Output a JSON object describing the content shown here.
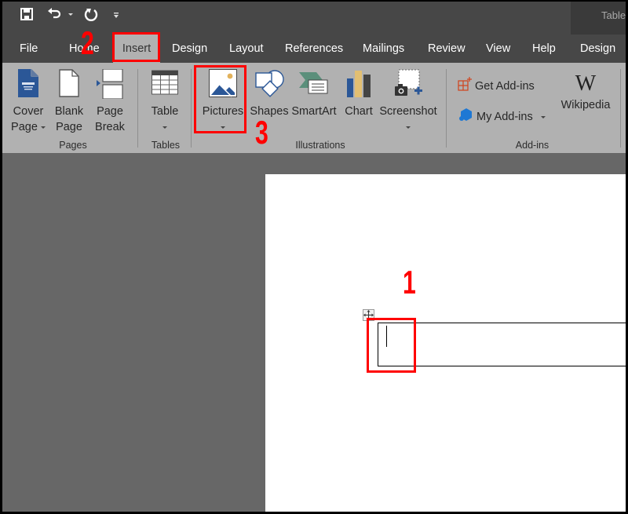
{
  "window": {
    "contextual_tab_group": "Table"
  },
  "quick_access": [
    {
      "name": "save-icon"
    },
    {
      "name": "undo-icon"
    },
    {
      "name": "redo-icon"
    },
    {
      "name": "customize-qat-icon"
    }
  ],
  "tabs": [
    {
      "label": "File",
      "active": false
    },
    {
      "label": "Home",
      "active": false
    },
    {
      "label": "Insert",
      "active": true
    },
    {
      "label": "Design",
      "active": false
    },
    {
      "label": "Layout",
      "active": false
    },
    {
      "label": "References",
      "active": false
    },
    {
      "label": "Mailings",
      "active": false
    },
    {
      "label": "Review",
      "active": false
    },
    {
      "label": "View",
      "active": false
    },
    {
      "label": "Help",
      "active": false
    },
    {
      "label": "Design",
      "active": false,
      "contextual": true
    }
  ],
  "ribbon": {
    "groups": {
      "pages": "Pages",
      "tables": "Tables",
      "illustrations": "Illustrations",
      "addins": "Add-ins"
    },
    "buttons": {
      "cover_page": [
        "Cover",
        "Page"
      ],
      "blank_page": [
        "Blank",
        "Page"
      ],
      "page_break": [
        "Page",
        "Break"
      ],
      "table": "Table",
      "pictures": "Pictures",
      "shapes": "Shapes",
      "smartart": "SmartArt",
      "chart": "Chart",
      "screenshot": "Screenshot",
      "get_addins": "Get Add-ins",
      "my_addins": "My Add-ins",
      "wikipedia": "Wikipedia",
      "wikipedia_glyph": "W"
    }
  },
  "annotations": {
    "step1": "1",
    "step2": "2",
    "step3": "3",
    "color": "#ff0000"
  },
  "colors": {
    "titlebar": "#474747",
    "ribbon": "#b1b1b1",
    "canvas": "#676767",
    "brand_blue": "#2b5797"
  }
}
